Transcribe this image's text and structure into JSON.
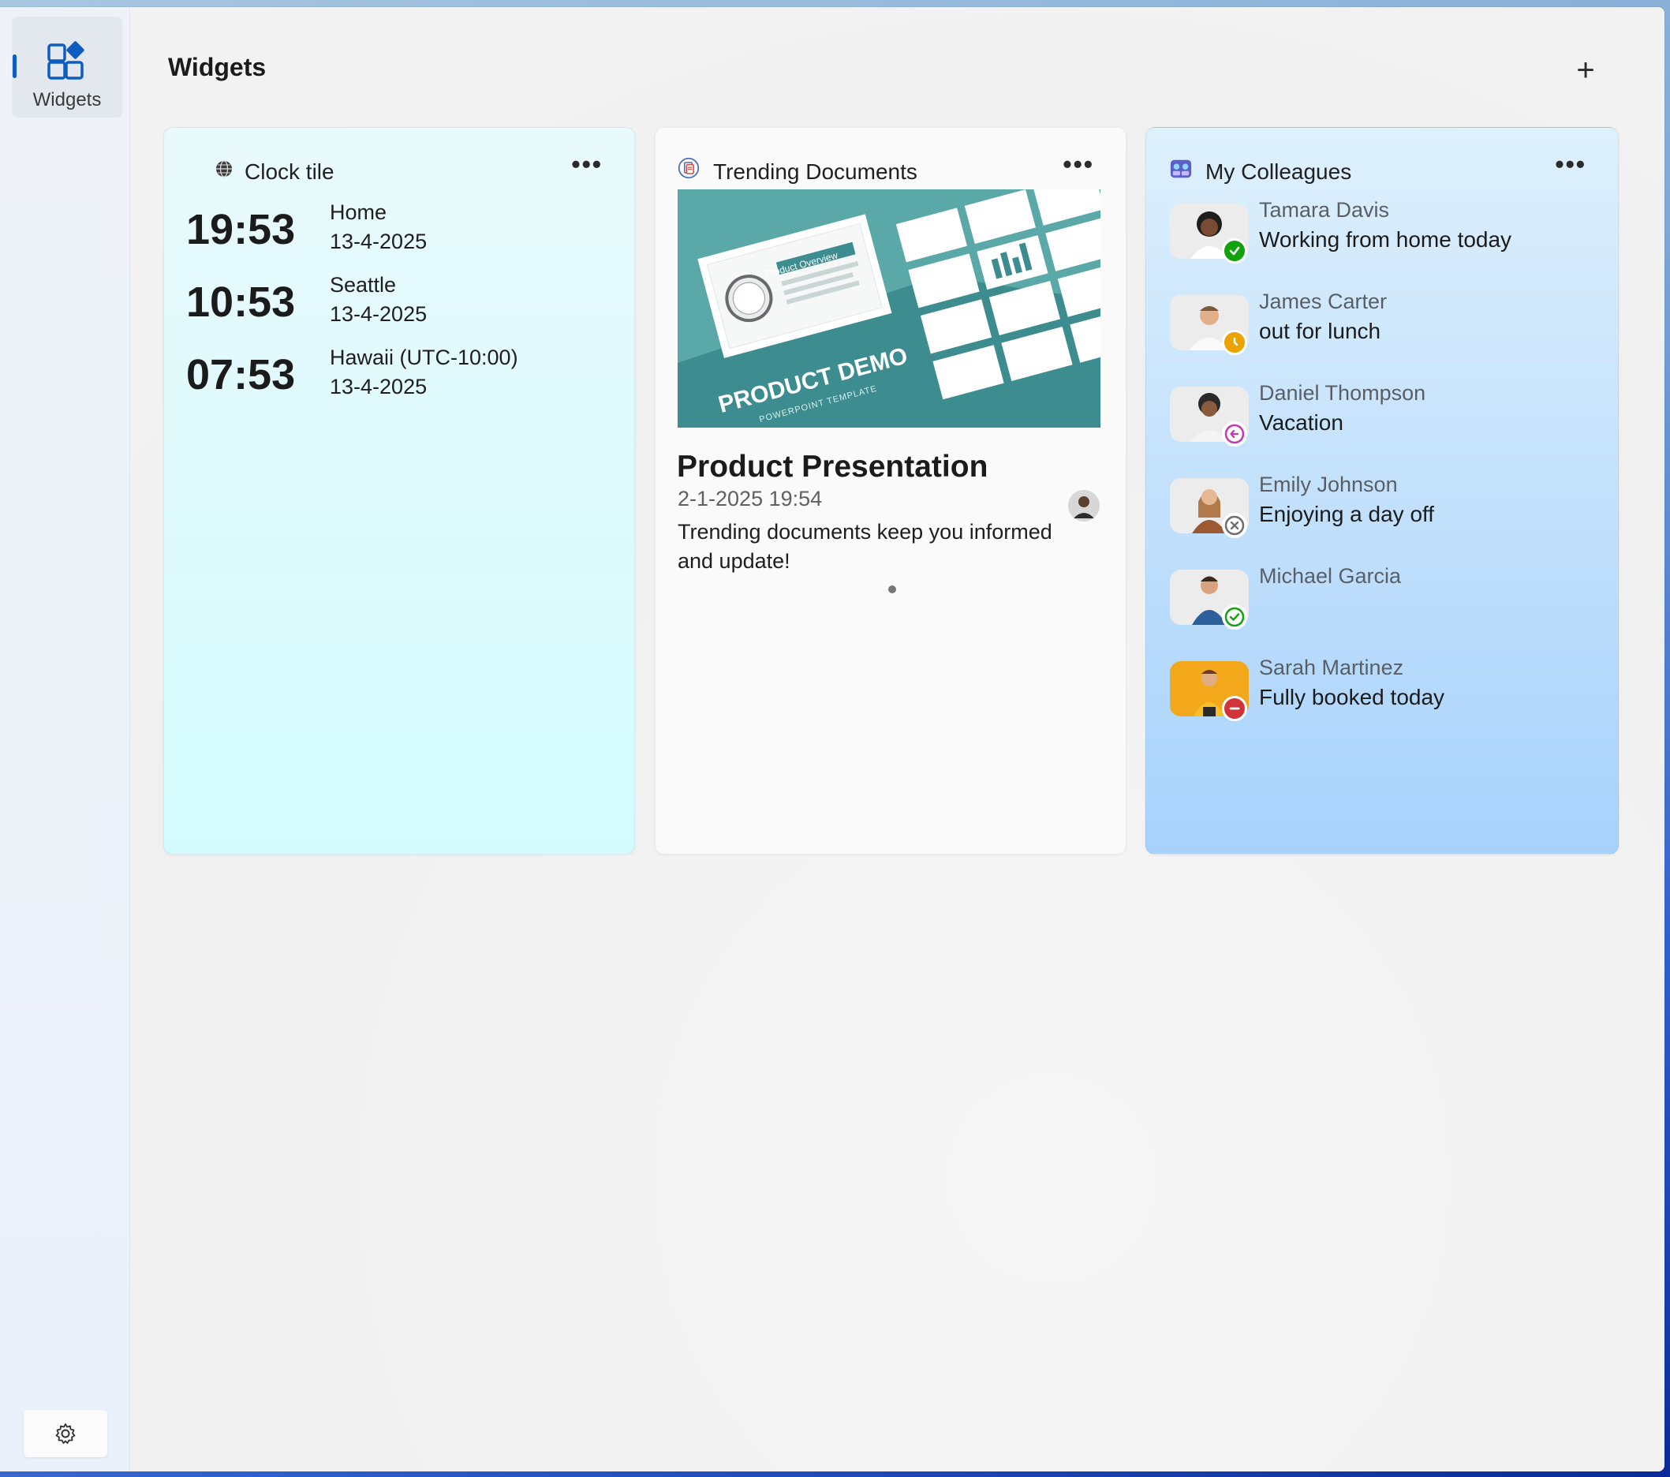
{
  "nav": {
    "widgets_label": "Widgets",
    "settings_icon": "gear-icon"
  },
  "header": {
    "title": "Widgets",
    "add_icon": "+"
  },
  "clock_tile": {
    "title": "Clock tile",
    "icon": "globe-icon",
    "more": "•••",
    "entries": [
      {
        "time": "19:53",
        "place": "Home",
        "date": "13-4-2025"
      },
      {
        "time": "10:53",
        "place": "Seattle",
        "date": "13-4-2025"
      },
      {
        "time": "07:53",
        "place": "Hawaii (UTC-10:00)",
        "date": "13-4-2025"
      }
    ]
  },
  "trending": {
    "title": "Trending Documents",
    "icon": "document-icon",
    "more": "•••",
    "thumbnail_text": "PRODUCT DEMO",
    "thumbnail_subtext": "POWERPOINT TEMPLATE",
    "thumbnail_label": "Product Overview",
    "doc_title": "Product Presentation",
    "doc_date": "2-1-2025 19:54",
    "description": "Trending documents keep you informed and update!"
  },
  "colleagues": {
    "title": "My Colleagues",
    "icon": "people-icon",
    "more": "•••",
    "people": [
      {
        "name": "Tamara Davis",
        "status": "Working from home today",
        "presence": "available",
        "color": "#13a10e"
      },
      {
        "name": "James Carter",
        "status": "out for lunch",
        "presence": "away",
        "color": "#eaa300"
      },
      {
        "name": "Daniel Thompson",
        "status": "Vacation",
        "presence": "out-of-office",
        "color": "#c239b3"
      },
      {
        "name": "Emily Johnson",
        "status": "Enjoying a day off",
        "presence": "offline",
        "color": "#6e6e6e"
      },
      {
        "name": "Michael Garcia",
        "status": "",
        "presence": "available-outline",
        "color": "#13a10e"
      },
      {
        "name": "Sarah Martinez",
        "status": "Fully booked today",
        "presence": "busy",
        "color": "#d13438"
      }
    ]
  }
}
